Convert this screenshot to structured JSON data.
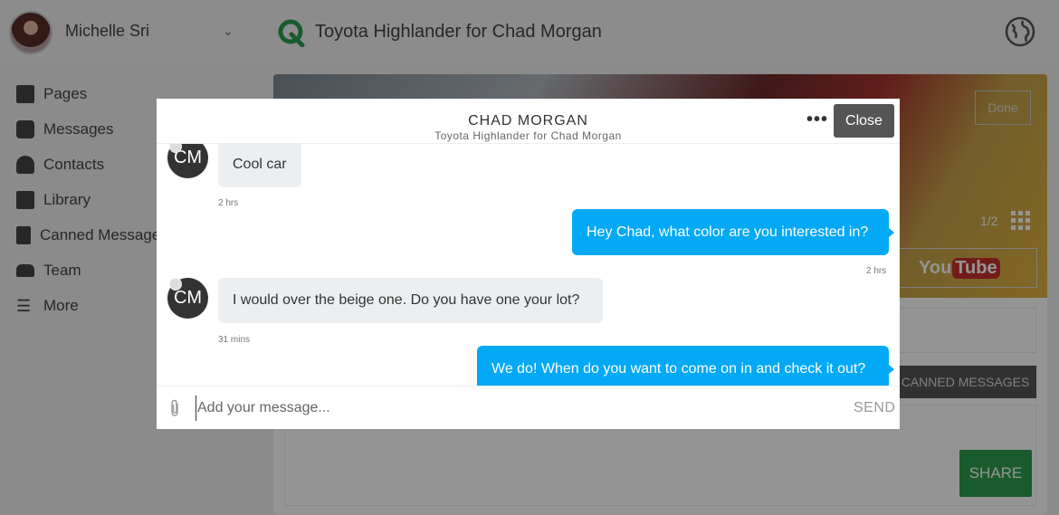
{
  "user": {
    "name": "Michelle Sri"
  },
  "header": {
    "title": "Toyota Highlander for Chad Morgan"
  },
  "sidebar": {
    "items": [
      {
        "label": "Pages",
        "icon": "pages-icon"
      },
      {
        "label": "Messages",
        "icon": "messages-icon"
      },
      {
        "label": "Contacts",
        "icon": "contacts-icon"
      },
      {
        "label": "Library",
        "icon": "library-icon"
      },
      {
        "label": "Canned Messages",
        "icon": "canned-messages-icon"
      },
      {
        "label": "Team",
        "icon": "team-icon"
      },
      {
        "label": "More",
        "icon": "menu-icon"
      }
    ]
  },
  "background": {
    "done_label": "Done",
    "photo_counter": "1/2",
    "youtube_you": "You",
    "youtube_tube": "Tube",
    "canned_label": "CANNED MESSAGES",
    "share_label": "SHARE"
  },
  "modal": {
    "contact_name": "CHAD MORGAN",
    "subtitle": "Toyota Highlander for Chad Morgan",
    "more_label": "•••",
    "close_label": "Close",
    "messages": [
      {
        "direction": "in",
        "initials": "CM",
        "text": "Cool car",
        "time": "2 hrs"
      },
      {
        "direction": "out",
        "text": "Hey Chad, what color are you interested in?",
        "time": "2 hrs"
      },
      {
        "direction": "in",
        "initials": "CM",
        "text": "I would over the beige one. Do you have one your lot?",
        "time": "31 mins"
      },
      {
        "direction": "out",
        "text": "We do! When do you want to come on in and check it out?"
      }
    ],
    "composer": {
      "placeholder": "Add your message...",
      "send_label": "SEND"
    }
  },
  "colors": {
    "outgoing_bubble": "#03a9f4",
    "incoming_bubble": "#eceff1",
    "share_button": "#2e9e4f",
    "close_button": "#555555"
  }
}
